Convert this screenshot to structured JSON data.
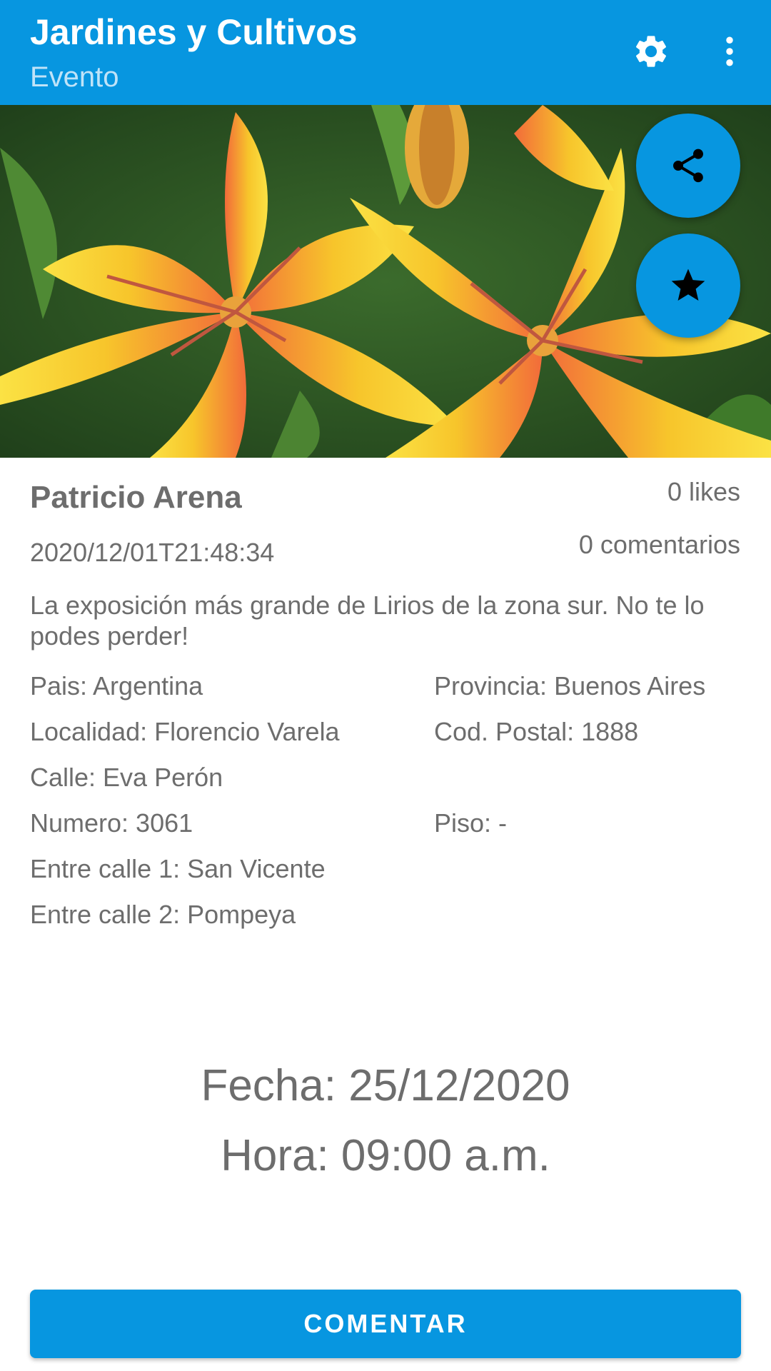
{
  "appbar": {
    "title": "Jardines y Cultivos",
    "subtitle": "Evento",
    "settings_icon": "gear-icon",
    "more_icon": "more-vert-icon",
    "color": "#0796e0"
  },
  "hero": {
    "image": "orange-yellow-lilies-photo",
    "share_icon": "share-icon",
    "favorite_icon": "star-icon"
  },
  "post": {
    "author": "Patricio Arena",
    "likes": "0 likes",
    "timestamp": "2020/12/01T21:48:34",
    "comments": "0 comentarios",
    "description": "La exposición más grande de Lirios de la zona sur. No te lo podes perder!"
  },
  "address": {
    "pais": "Pais: Argentina",
    "provincia": "Provincia: Buenos Aires",
    "localidad": "Localidad: Florencio Varela",
    "cod_postal": "Cod. Postal: 1888",
    "calle": "Calle: Eva Perón",
    "numero": "Numero: 3061",
    "piso": "Piso: -",
    "entre_calle_1": "Entre calle 1: San Vicente",
    "entre_calle_2": "Entre calle 2: Pompeya"
  },
  "event": {
    "fecha": "Fecha: 25/12/2020",
    "hora": "Hora: 09:00 a.m."
  },
  "actions": {
    "comment_label": "COMENTAR"
  },
  "colors": {
    "accent": "#0796e0",
    "text": "#6d6d6d"
  }
}
